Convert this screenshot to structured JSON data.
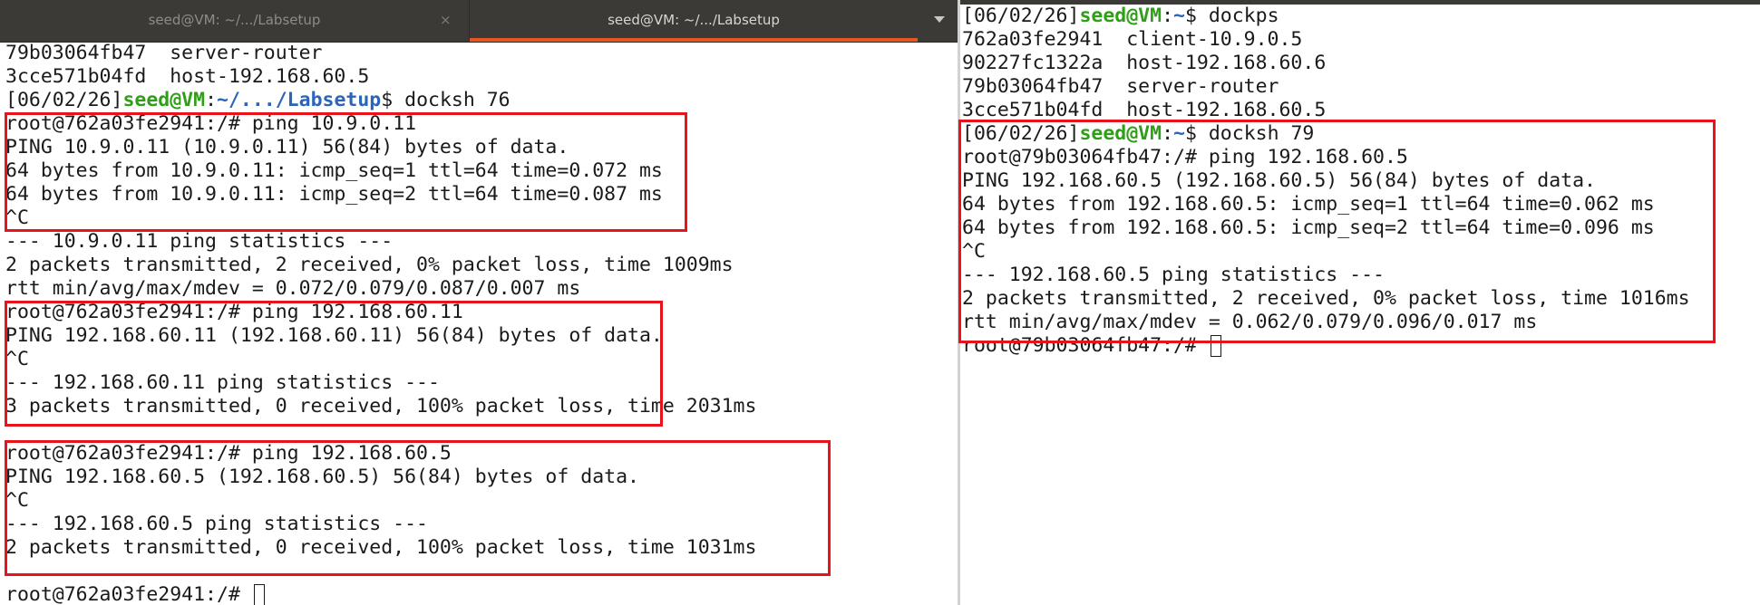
{
  "left": {
    "tabs": [
      {
        "title": "seed@VM: ~/.../Labsetup",
        "close": "×"
      },
      {
        "title": "seed@VM: ~/.../Labsetup"
      }
    ],
    "lines": [
      "79b03064fb47  server-router",
      "3cce571b04fd  host-192.168.60.5",
      {
        "prompt": {
          "date": "[06/02/26]",
          "user": "seed@VM",
          "sep": ":",
          "path": "~/.../Labsetup",
          "sym": "$",
          "cmd": " docksh 76"
        }
      },
      "root@762a03fe2941:/# ping 10.9.0.11",
      "PING 10.9.0.11 (10.9.0.11) 56(84) bytes of data.",
      "64 bytes from 10.9.0.11: icmp_seq=1 ttl=64 time=0.072 ms",
      "64 bytes from 10.9.0.11: icmp_seq=2 ttl=64 time=0.087 ms",
      "^C",
      "--- 10.9.0.11 ping statistics ---",
      "2 packets transmitted, 2 received, 0% packet loss, time 1009ms",
      "rtt min/avg/max/mdev = 0.072/0.079/0.087/0.007 ms",
      "root@762a03fe2941:/# ping 192.168.60.11",
      "PING 192.168.60.11 (192.168.60.11) 56(84) bytes of data.",
      "^C",
      "--- 192.168.60.11 ping statistics ---",
      "3 packets transmitted, 0 received, 100% packet loss, time 2031ms",
      "",
      "root@762a03fe2941:/# ping 192.168.60.5",
      "PING 192.168.60.5 (192.168.60.5) 56(84) bytes of data.",
      "^C",
      "--- 192.168.60.5 ping statistics ---",
      "2 packets transmitted, 0 received, 100% packet loss, time 1031ms",
      "",
      "root@762a03fe2941:/# "
    ]
  },
  "right": {
    "lines": [
      {
        "prompt": {
          "date": "[06/02/26]",
          "user": "seed@VM",
          "sep": ":",
          "path": "~",
          "sym": "$",
          "cmd": " dockps"
        }
      },
      "762a03fe2941  client-10.9.0.5",
      "90227fc1322a  host-192.168.60.6",
      "79b03064fb47  server-router",
      "3cce571b04fd  host-192.168.60.5",
      {
        "prompt": {
          "date": "[06/02/26]",
          "user": "seed@VM",
          "sep": ":",
          "path": "~",
          "sym": "$",
          "cmd": " docksh 79"
        }
      },
      "root@79b03064fb47:/# ping 192.168.60.5",
      "PING 192.168.60.5 (192.168.60.5) 56(84) bytes of data.",
      "64 bytes from 192.168.60.5: icmp_seq=1 ttl=64 time=0.062 ms",
      "64 bytes from 192.168.60.5: icmp_seq=2 ttl=64 time=0.096 ms",
      "^C",
      "--- 192.168.60.5 ping statistics ---",
      "2 packets transmitted, 2 received, 0% packet loss, time 1016ms",
      "rtt min/avg/max/mdev = 0.062/0.079/0.096/0.017 ms",
      "root@79b03064fb47:/# "
    ]
  },
  "colors": {
    "prompt_user": "#2f9e18",
    "prompt_path": "#2b65b8",
    "highlight_box": "#e8141b",
    "tab_accent": "#e95420"
  }
}
